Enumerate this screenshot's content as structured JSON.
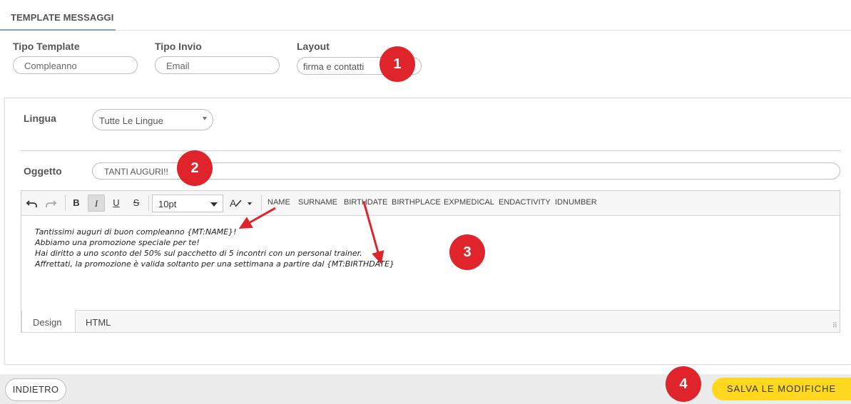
{
  "header": {
    "tab_title": "TEMPLATE MESSAGGI"
  },
  "fields": {
    "tipo_template": {
      "label": "Tipo Template",
      "value": "Compleanno"
    },
    "tipo_invio": {
      "label": "Tipo Invio",
      "value": "Email"
    },
    "layout": {
      "label": "Layout",
      "value": "firma e contatti"
    }
  },
  "form": {
    "lingua_label": "Lingua",
    "lingua_value": "Tutte Le Lingue",
    "oggetto_label": "Oggetto",
    "oggetto_value": "TANTI AUGURI!!"
  },
  "editor": {
    "toolbar": {
      "undo_icon": "undo-icon",
      "redo_icon": "redo-icon",
      "bold": "B",
      "italic": "I",
      "underline": "U",
      "strike": "S",
      "font_size": "10pt",
      "format_icon": "text-format-icon",
      "variables": [
        "NAME",
        "SURNAME",
        "BIRTHDATE",
        "BIRTHPLACE",
        "EXPMEDICAL",
        "ENDACTIVITY",
        "IDNUMBER"
      ]
    },
    "content_lines": [
      "Tantissimi auguri di buon compleanno {MT:NAME}!",
      "Abbiamo una promozione speciale per te!",
      "Hai diritto a uno sconto del 50% sul pacchetto di 5 incontri con un personal trainer.",
      "Affrettati, la promozione è valida soltanto per una settimana a partire dal {MT:BIRTHDATE}"
    ],
    "modes": {
      "design": "Design",
      "html": "HTML"
    }
  },
  "footer": {
    "back_label": "INDIETRO",
    "save_label": "SALVA LE MODIFICHE"
  },
  "annotations": [
    "1",
    "2",
    "3",
    "4"
  ],
  "colors": {
    "accent_yellow": "#ffd81f",
    "annotation_red": "#e0242b",
    "tab_underline": "#7aa7c7"
  }
}
